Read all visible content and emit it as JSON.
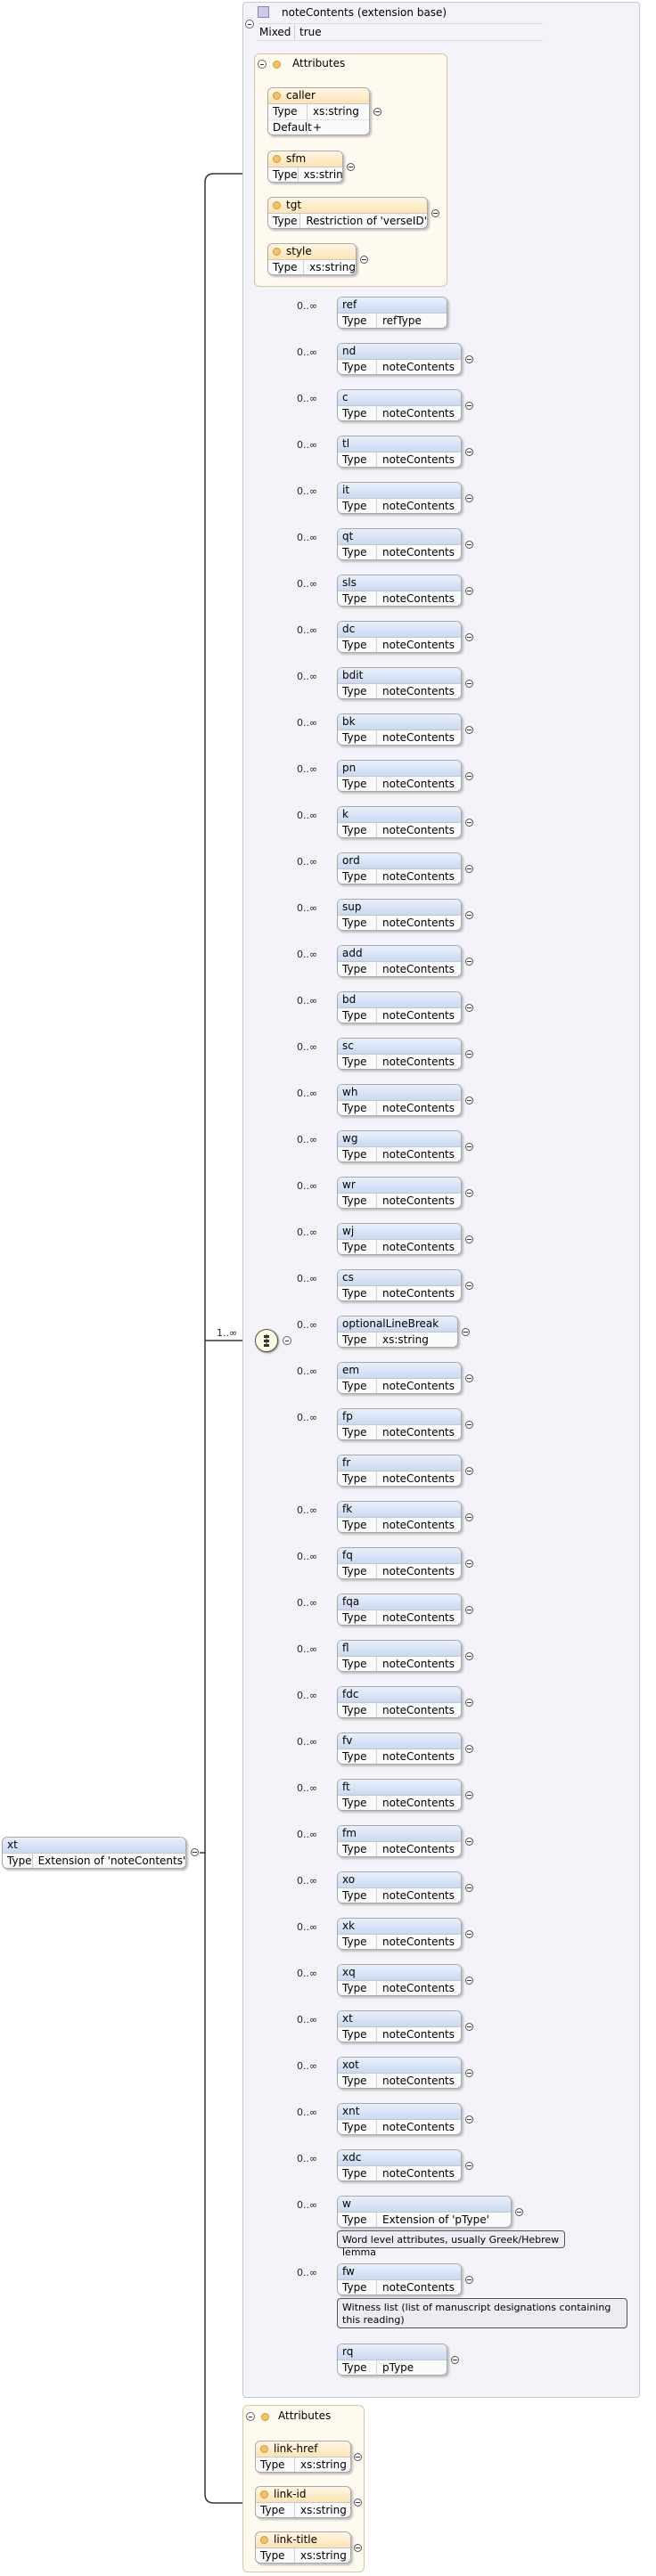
{
  "root": {
    "name": "xt",
    "type_label": "Type",
    "type_value": "Extension of 'noteContents'"
  },
  "extension": {
    "title": "noteContents (extension base)",
    "mixed_label": "Mixed",
    "mixed_value": "true"
  },
  "attributes_label": "Attributes",
  "ext_attributes": [
    {
      "name": "caller",
      "rows": [
        {
          "k": "Type",
          "v": "xs:string"
        },
        {
          "k": "Default",
          "v": "+"
        }
      ]
    },
    {
      "name": "sfm",
      "rows": [
        {
          "k": "Type",
          "v": "xs:string"
        }
      ]
    },
    {
      "name": "tgt",
      "rows": [
        {
          "k": "Type",
          "v": "Restriction of 'verseID'"
        }
      ]
    },
    {
      "name": "style",
      "rows": [
        {
          "k": "Type",
          "v": "xs:string"
        }
      ]
    }
  ],
  "sequence_occurrence": "1..∞",
  "type_label": "Type",
  "children": [
    {
      "name": "ref",
      "type": "refType",
      "occ": "0..∞"
    },
    {
      "name": "nd",
      "type": "noteContents",
      "occ": "0..∞"
    },
    {
      "name": "c",
      "type": "noteContents",
      "occ": "0..∞"
    },
    {
      "name": "tl",
      "type": "noteContents",
      "occ": "0..∞"
    },
    {
      "name": "it",
      "type": "noteContents",
      "occ": "0..∞"
    },
    {
      "name": "qt",
      "type": "noteContents",
      "occ": "0..∞"
    },
    {
      "name": "sls",
      "type": "noteContents",
      "occ": "0..∞"
    },
    {
      "name": "dc",
      "type": "noteContents",
      "occ": "0..∞"
    },
    {
      "name": "bdit",
      "type": "noteContents",
      "occ": "0..∞"
    },
    {
      "name": "bk",
      "type": "noteContents",
      "occ": "0..∞"
    },
    {
      "name": "pn",
      "type": "noteContents",
      "occ": "0..∞"
    },
    {
      "name": "k",
      "type": "noteContents",
      "occ": "0..∞"
    },
    {
      "name": "ord",
      "type": "noteContents",
      "occ": "0..∞"
    },
    {
      "name": "sup",
      "type": "noteContents",
      "occ": "0..∞"
    },
    {
      "name": "add",
      "type": "noteContents",
      "occ": "0..∞"
    },
    {
      "name": "bd",
      "type": "noteContents",
      "occ": "0..∞"
    },
    {
      "name": "sc",
      "type": "noteContents",
      "occ": "0..∞"
    },
    {
      "name": "wh",
      "type": "noteContents",
      "occ": "0..∞"
    },
    {
      "name": "wg",
      "type": "noteContents",
      "occ": "0..∞"
    },
    {
      "name": "wr",
      "type": "noteContents",
      "occ": "0..∞"
    },
    {
      "name": "wj",
      "type": "noteContents",
      "occ": "0..∞"
    },
    {
      "name": "cs",
      "type": "noteContents",
      "occ": "0..∞"
    },
    {
      "name": "optionalLineBreak",
      "type": "xs:string",
      "occ": "0..∞"
    },
    {
      "name": "em",
      "type": "noteContents",
      "occ": "0..∞"
    },
    {
      "name": "fp",
      "type": "noteContents",
      "occ": "0..∞"
    },
    {
      "name": "fr",
      "type": "noteContents",
      "occ": ""
    },
    {
      "name": "fk",
      "type": "noteContents",
      "occ": "0..∞"
    },
    {
      "name": "fq",
      "type": "noteContents",
      "occ": "0..∞"
    },
    {
      "name": "fqa",
      "type": "noteContents",
      "occ": "0..∞"
    },
    {
      "name": "fl",
      "type": "noteContents",
      "occ": "0..∞"
    },
    {
      "name": "fdc",
      "type": "noteContents",
      "occ": "0..∞"
    },
    {
      "name": "fv",
      "type": "noteContents",
      "occ": "0..∞"
    },
    {
      "name": "ft",
      "type": "noteContents",
      "occ": "0..∞"
    },
    {
      "name": "fm",
      "type": "noteContents",
      "occ": "0..∞"
    },
    {
      "name": "xo",
      "type": "noteContents",
      "occ": "0..∞"
    },
    {
      "name": "xk",
      "type": "noteContents",
      "occ": "0..∞"
    },
    {
      "name": "xq",
      "type": "noteContents",
      "occ": "0..∞"
    },
    {
      "name": "xt",
      "type": "noteContents",
      "occ": "0..∞"
    },
    {
      "name": "xot",
      "type": "noteContents",
      "occ": "0..∞"
    },
    {
      "name": "xnt",
      "type": "noteContents",
      "occ": "0..∞"
    },
    {
      "name": "xdc",
      "type": "noteContents",
      "occ": "0..∞"
    },
    {
      "name": "w",
      "type": "Extension of 'pType'",
      "occ": "0..∞",
      "note": "Word level attributes, usually Greek/Hebrew lemma"
    },
    {
      "name": "fw",
      "type": "noteContents",
      "occ": "0..∞",
      "note": "Witness list (list of manuscript designations containing this reading)"
    },
    {
      "name": "rq",
      "type": "pType",
      "occ": ""
    }
  ],
  "link_attributes": [
    {
      "name": "link-href",
      "type": "xs:string"
    },
    {
      "name": "link-id",
      "type": "xs:string"
    },
    {
      "name": "link-title",
      "type": "xs:string"
    }
  ],
  "colors": {
    "element_header": "#c9d9f3",
    "attribute_header": "#fde3b1",
    "attribute_icon": "#f1c26b",
    "card_bg": "#f3f3f9"
  }
}
